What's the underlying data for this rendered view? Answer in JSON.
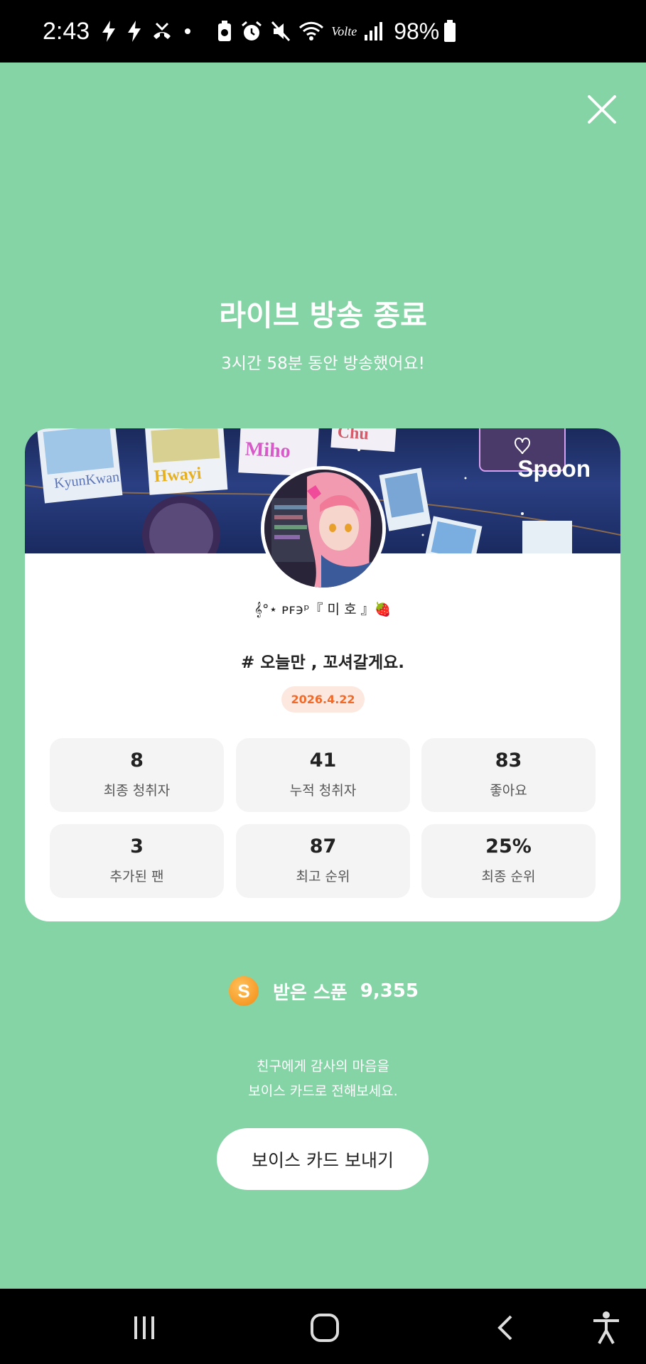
{
  "status_bar": {
    "time": "2:43",
    "battery_percent": "98%",
    "network": "Volte"
  },
  "close_icon": "close-icon",
  "header": {
    "title": "라이브 방송 종료",
    "subtitle": "3시간 58분 동안 방송했어요!"
  },
  "card": {
    "brand": "Spoon",
    "nickname": "𝄞°⋆ ᴘꜰ϶ᵖ『 미 호 』🍓",
    "broadcast_title": "# 오늘만 , 꼬셔갈게요.",
    "date": "2026.4.22",
    "stats": [
      {
        "value": "8",
        "label": "최종 청취자"
      },
      {
        "value": "41",
        "label": "누적 청취자"
      },
      {
        "value": "83",
        "label": "좋아요"
      },
      {
        "value": "3",
        "label": "추가된 팬"
      },
      {
        "value": "87",
        "label": "최고 순위"
      },
      {
        "value": "25%",
        "label": "최종 순위"
      }
    ]
  },
  "spoons": {
    "coin_letter": "S",
    "label": "받은 스푼",
    "amount": "9,355"
  },
  "thanks": {
    "line1": "친구에게 감사의 마음을",
    "line2": "보이스 카드로 전해보세요."
  },
  "voice_card_button": "보이스 카드 보내기",
  "colors": {
    "background": "#84d4a6",
    "date_badge_text": "#f06a2a",
    "date_badge_bg": "#fde8df"
  }
}
